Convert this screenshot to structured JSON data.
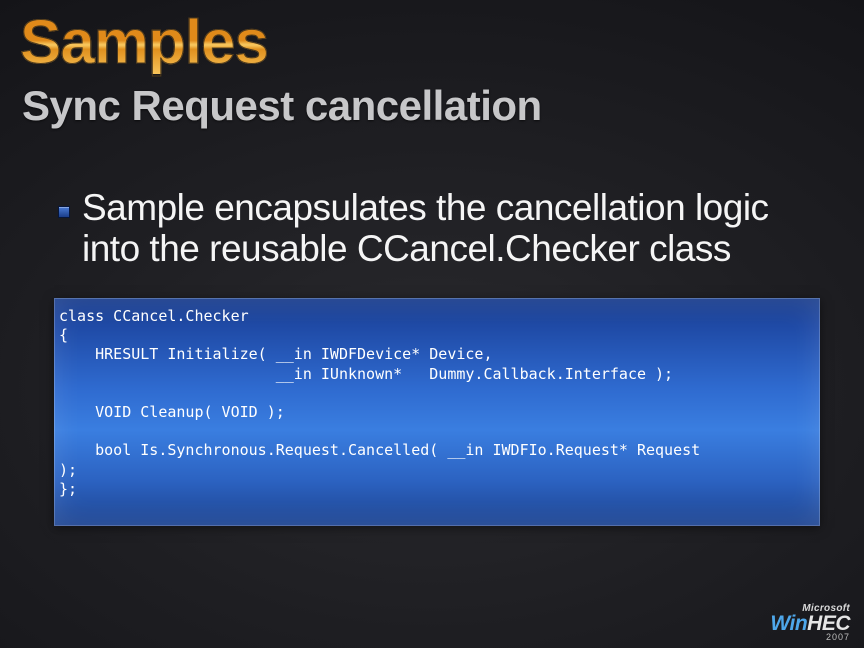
{
  "title": "Samples",
  "subtitle": "Sync Request cancellation",
  "bullet": "Sample encapsulates the cancellation logic into the reusable CCancel.Checker class",
  "code": "class CCancel.Checker\n{\n    HRESULT Initialize( __in IWDFDevice* Device,\n                        __in IUnknown*   Dummy.Callback.Interface );\n\n    VOID Cleanup( VOID );\n\n    bool Is.Synchronous.Request.Cancelled( __in IWDFIo.Request* Request\n);\n};",
  "footer": {
    "vendor": "Microsoft",
    "brand_left": "Win",
    "brand_right": "HEC",
    "year": "2007"
  }
}
